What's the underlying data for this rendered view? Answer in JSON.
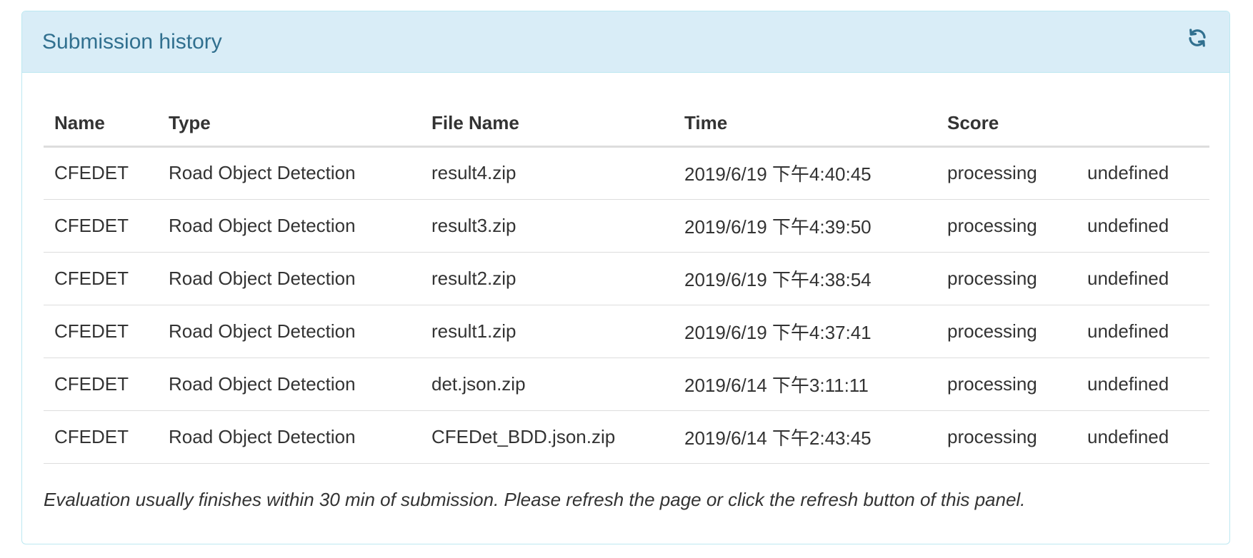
{
  "panel": {
    "title": "Submission history",
    "refresh_icon": "refresh-icon"
  },
  "table": {
    "headers": [
      "Name",
      "Type",
      "File Name",
      "Time",
      "Score",
      ""
    ],
    "rows": [
      {
        "name": "CFEDET",
        "type": "Road Object Detection",
        "file": "result4.zip",
        "time": "2019/6/19 下午4:40:45",
        "score": "processing",
        "extra": "undefined"
      },
      {
        "name": "CFEDET",
        "type": "Road Object Detection",
        "file": "result3.zip",
        "time": "2019/6/19 下午4:39:50",
        "score": "processing",
        "extra": "undefined"
      },
      {
        "name": "CFEDET",
        "type": "Road Object Detection",
        "file": "result2.zip",
        "time": "2019/6/19 下午4:38:54",
        "score": "processing",
        "extra": "undefined"
      },
      {
        "name": "CFEDET",
        "type": "Road Object Detection",
        "file": "result1.zip",
        "time": "2019/6/19 下午4:37:41",
        "score": "processing",
        "extra": "undefined"
      },
      {
        "name": "CFEDET",
        "type": "Road Object Detection",
        "file": "det.json.zip",
        "time": "2019/6/14 下午3:11:11",
        "score": "processing",
        "extra": "undefined"
      },
      {
        "name": "CFEDET",
        "type": "Road Object Detection",
        "file": "CFEDet_BDD.json.zip",
        "time": "2019/6/14 下午2:43:45",
        "score": "processing",
        "extra": "undefined"
      }
    ]
  },
  "note": "Evaluation usually finishes within 30 min of submission. Please refresh the page or click the refresh button of this panel.",
  "colors": {
    "heading_bg": "#d9edf7",
    "heading_text": "#31708f",
    "border": "#bce8f1"
  }
}
